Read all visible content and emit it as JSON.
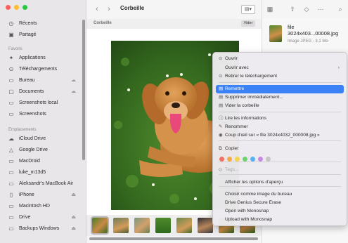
{
  "sidebar": {
    "favorites_top": [
      {
        "label": "Récents",
        "icon": "clock-icon"
      },
      {
        "label": "Partagé",
        "icon": "shared-folder-icon"
      }
    ],
    "favorites_heading": "Favoris",
    "favorites": [
      {
        "label": "Applications",
        "icon": "applications-icon",
        "cloud": false
      },
      {
        "label": "Téléchargements",
        "icon": "download-icon",
        "cloud": false
      },
      {
        "label": "Bureau",
        "icon": "desktop-folder-icon",
        "cloud": true
      },
      {
        "label": "Documents",
        "icon": "document-folder-icon",
        "cloud": true
      },
      {
        "label": "Screenshots local",
        "icon": "folder-icon",
        "cloud": false
      },
      {
        "label": "Screenshots",
        "icon": "folder-icon",
        "cloud": false
      }
    ],
    "locations_heading": "Emplacements",
    "locations": [
      {
        "label": "iCloud Drive",
        "icon": "cloud-icon",
        "eject": false
      },
      {
        "label": "Google Drive",
        "icon": "drive-icon",
        "eject": false
      },
      {
        "label": "MacDroid",
        "icon": "disk-icon",
        "eject": false
      },
      {
        "label": "luke_m13d5",
        "icon": "disk-icon",
        "eject": false
      },
      {
        "label": "Aleksandr's MacBook Air",
        "icon": "laptop-icon",
        "eject": false
      },
      {
        "label": "iPhone",
        "icon": "phone-icon",
        "eject": true
      },
      {
        "label": "Macintosh HD",
        "icon": "disk-icon",
        "eject": false
      },
      {
        "label": "Drive",
        "icon": "disk-icon",
        "eject": true
      },
      {
        "label": "Backups Windows",
        "icon": "disk-icon",
        "eject": true
      }
    ]
  },
  "toolbar": {
    "back_glyph": "‹",
    "forward_glyph": "›",
    "title": "Corbeille",
    "view_glyph": "▤▾"
  },
  "path_bar": {
    "label": "Corbeille",
    "empty_button": "Vider"
  },
  "right_toolbar": {
    "grid_glyph": "▦",
    "share_glyph": "⇧",
    "tag_glyph": "◇",
    "more_glyph": "···",
    "search_glyph": "⌕"
  },
  "info_panel": {
    "name_line1": "file",
    "name_line2": "3024x403...00008.jpg",
    "subtitle": "Image JPEG - 3,1 Mo"
  },
  "context_menu": {
    "items": [
      {
        "label": "Ouvrir",
        "icon": "⊙",
        "name": "open"
      },
      {
        "label": "Ouvrir avec",
        "icon": "",
        "name": "open-with",
        "submenu": true
      },
      {
        "label": "Retirer le téléchargement",
        "icon": "⊙",
        "name": "remove-download"
      },
      {
        "label": "Remettre",
        "icon": "▤",
        "name": "put-back",
        "highlighted": true
      },
      {
        "label": "Supprimer immédiatement...",
        "icon": "▤",
        "name": "delete-immediately"
      },
      {
        "label": "Vider la corbeille",
        "icon": "▤",
        "name": "empty-trash"
      },
      {
        "label": "Lire les informations",
        "icon": "ⓘ",
        "name": "get-info"
      },
      {
        "label": "Renommer",
        "icon": "✎",
        "name": "rename"
      },
      {
        "label": "Coup d'œil sur « file 3024x4032_000008.jpg »",
        "icon": "◉",
        "name": "quick-look"
      },
      {
        "label": "Copier",
        "icon": "⧉",
        "name": "copy"
      },
      {
        "label": "Tags...",
        "icon": "◇",
        "name": "tags",
        "disabled": true
      },
      {
        "label": "Afficher les options d'aperçu",
        "icon": "",
        "name": "show-view-options"
      },
      {
        "label": "Choisir comme image du bureau",
        "icon": "",
        "name": "set-desktop-picture"
      },
      {
        "label": "Drive Genius Secure Erase",
        "icon": "",
        "name": "drive-genius-erase"
      },
      {
        "label": "Open with Monosnap",
        "icon": "",
        "name": "open-with-monosnap"
      },
      {
        "label": "Upload with Monosnap",
        "icon": "",
        "name": "upload-with-monosnap"
      }
    ],
    "tag_colors": [
      "#f47063",
      "#f6a94a",
      "#f5d54b",
      "#6cd26b",
      "#58b2f2",
      "#c68ae4",
      "#c6c4c7"
    ]
  },
  "colors": {
    "accent": "#3a82f6",
    "traffic_close": "#fe5f57",
    "traffic_min": "#febc2e",
    "traffic_max": "#28c840"
  }
}
